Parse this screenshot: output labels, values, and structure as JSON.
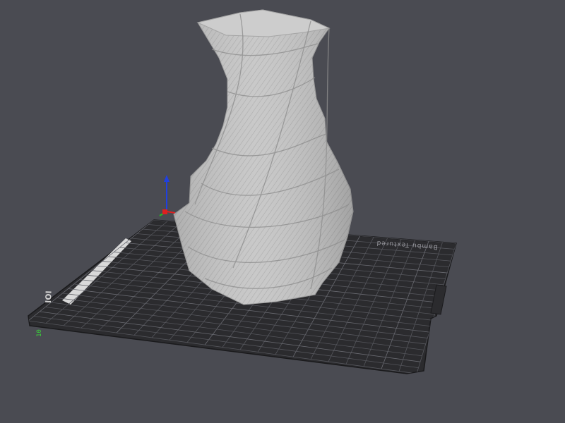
{
  "viewport": {
    "background": "#4a4b52"
  },
  "build_plate": {
    "label": "Bambu Textured",
    "label_orientation": "upside-down",
    "corner_label": "IOI",
    "plate_color": "#2b2b2e",
    "grid_color": "#55565c"
  },
  "origin": {
    "label": "10",
    "label_color": "#3ad13a"
  },
  "axes": {
    "x_color": "#e02020",
    "y_color": "#20c020",
    "z_color": "#2040e0"
  },
  "model": {
    "name": "twisted-vase",
    "color": "#c8c8c8"
  }
}
